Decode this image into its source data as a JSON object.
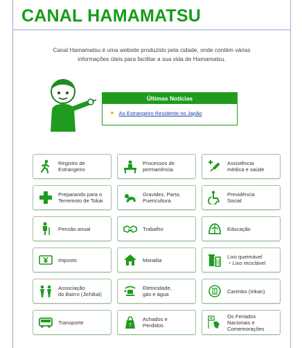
{
  "header": {
    "logo_text": "CANAL HAMAMATSU"
  },
  "intro": {
    "line1": "Canal Hamamatsu é uma website produzido pela cidade, onde contém várias",
    "line2": "informações úteis para facilitar a sua vida de Hamamatsu."
  },
  "news": {
    "title": "Últimas Notícias",
    "items": [
      {
        "label": "Ao Estrangeiro Residente no Japão"
      }
    ]
  },
  "tiles": [
    {
      "label": "Registro de\nEstrangeiro",
      "icon": "walking-person-icon"
    },
    {
      "label": "Processos de\npermanência",
      "icon": "office-desk-icon"
    },
    {
      "label": "Assistência\nmédica e saúde",
      "icon": "syringe-icon"
    },
    {
      "label": "Preparando para o\nTerremoto de Tokai",
      "icon": "cross-icon"
    },
    {
      "label": "Gravidez, Parto,\nPuericultura",
      "icon": "baby-icon"
    },
    {
      "label": "Previdência\nSocial",
      "icon": "wheelchair-icon"
    },
    {
      "label": "Pensão anual",
      "icon": "elderly-person-icon"
    },
    {
      "label": "Trabalho",
      "icon": "handshake-icon"
    },
    {
      "label": "Educação",
      "icon": "school-icon"
    },
    {
      "label": "Imposto",
      "icon": "yen-icon"
    },
    {
      "label": "Moradia",
      "icon": "house-icon"
    },
    {
      "label": "Lixo queimável\n・Lixo reciclável",
      "icon": "trash-bin-icon"
    },
    {
      "label": "Associação\ndo Bairro (Jichikai)",
      "icon": "people-icon"
    },
    {
      "label": "Eletricidade,\ngás e água",
      "icon": "utilities-icon"
    },
    {
      "label": "Carimbo (Inkan)",
      "icon": "stamp-icon"
    },
    {
      "label": "Transporte",
      "icon": "bus-icon"
    },
    {
      "label": "Achados e\nPerdidos",
      "icon": "bag-icon"
    },
    {
      "label": "Os Feriados\nNacionais e\nComemorações",
      "icon": "flag-icon"
    }
  ],
  "colors": {
    "brand_green": "#169c16",
    "link_blue": "#1b3fb0",
    "bullet": "#f2a400"
  }
}
